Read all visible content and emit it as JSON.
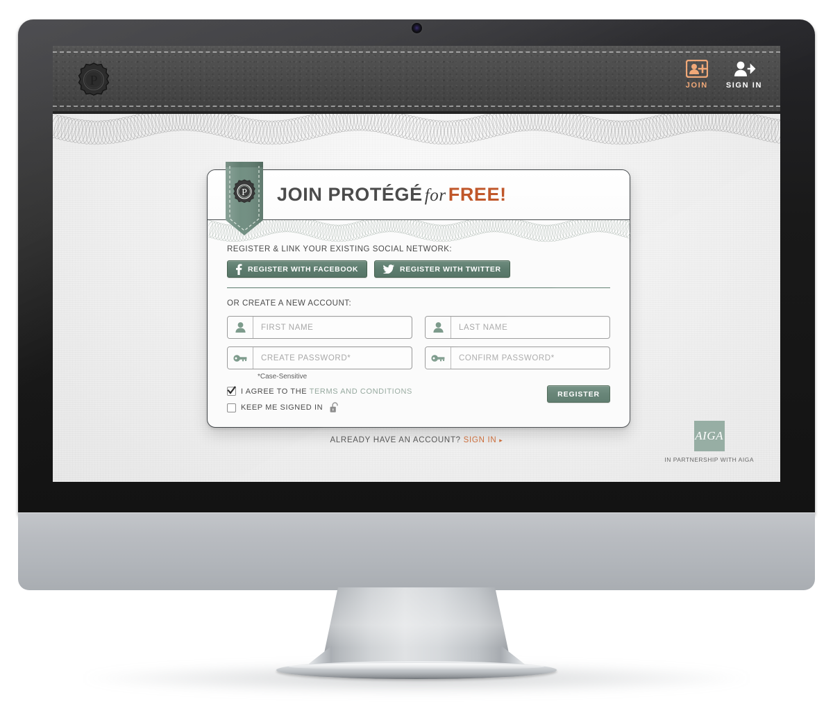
{
  "site": {
    "logo_letter": "P",
    "logo_name": "protege-badge-logo"
  },
  "topnav": {
    "join_label": "JOIN",
    "signin_label": "SIGN IN",
    "join_color": "#f0a878",
    "signin_color": "#ffffff",
    "background_color": "#4a4a4a"
  },
  "card": {
    "title_join": "JOIN PROTÉGÉ",
    "title_for": "for",
    "title_free": "FREE!",
    "ribbon_letter": "P",
    "accent_free_color": "#c0572a",
    "ribbon_color": "#6b8a7c"
  },
  "social": {
    "section_label": "REGISTER & LINK YOUR EXISTING SOCIAL NETWORK:",
    "buttons": [
      {
        "label": "REGISTER WITH FACEBOOK",
        "icon": "facebook-icon"
      },
      {
        "label": "REGISTER WITH TWITTER",
        "icon": "twitter-icon"
      }
    ]
  },
  "form": {
    "section_label": "OR CREATE A NEW ACCOUNT:",
    "fields": [
      {
        "name": "first-name",
        "placeholder": "FIRST NAME",
        "value": "",
        "icon": "person-icon"
      },
      {
        "name": "last-name",
        "placeholder": "LAST NAME",
        "value": "",
        "icon": "person-icon"
      },
      {
        "name": "create-password",
        "placeholder": "CREATE PASSWORD*",
        "value": "",
        "icon": "key-icon"
      },
      {
        "name": "confirm-password",
        "placeholder": "CONFIRM PASSWORD*",
        "value": "",
        "icon": "key-icon"
      }
    ],
    "case_note": "*Case-Sensitive",
    "agree_prefix": "I AGREE TO THE ",
    "agree_link": "TERMS AND CONDITIONS",
    "agree_checked": true,
    "keep_signed_label": "KEEP ME SIGNED IN",
    "keep_signed_checked": false,
    "register_button": "REGISTER"
  },
  "footer": {
    "already_text": "ALREADY HAVE AN ACCOUNT?",
    "signin_link": "SIGN IN",
    "arrow": "▸",
    "aiga_mark": "AIGA",
    "aiga_caption": "IN PARTNERSHIP WITH AIGA",
    "aiga_color": "#8ea79c"
  }
}
